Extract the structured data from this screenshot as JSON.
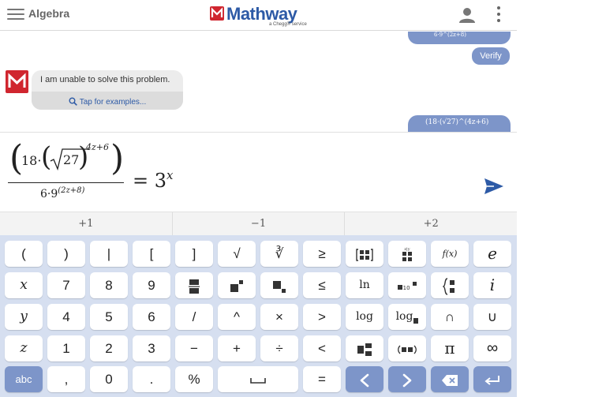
{
  "header": {
    "subject": "Algebra",
    "brand_name": "Mathway",
    "brand_sub": "a Chegg® service"
  },
  "chat": {
    "user_prev_fragment": "6·9^(2z+8)",
    "verify_label": "Verify",
    "bot_message": "I am unable to solve this problem.",
    "bot_link": "Tap for examples...",
    "user_next_fragment": "(18·(√27)^(4z+6)"
  },
  "input": {
    "coef": "18·",
    "radicand": "27",
    "exponent": "4z+6",
    "denominator_base": "6·9",
    "denominator_exp": "(2z+8)",
    "rhs_base": "= 3",
    "rhs_exp": "x"
  },
  "shortcuts": [
    "+1",
    "−1",
    "+2"
  ],
  "keys": {
    "row1": [
      "(",
      ")",
      "|",
      "[",
      "]",
      "√",
      "∛",
      "≥"
    ],
    "row2": [
      "x",
      "7",
      "8",
      "9",
      "",
      "",
      "",
      "≤",
      "ln",
      "",
      "",
      "i"
    ],
    "row3": [
      "y",
      "4",
      "5",
      "6",
      "/",
      "^",
      "×",
      ">",
      "log",
      "log",
      "∩",
      "∪"
    ],
    "row4": [
      "z",
      "1",
      "2",
      "3",
      "−",
      "+",
      "÷",
      "<",
      "",
      "",
      "π",
      "∞"
    ],
    "row5": [
      "abc",
      ",",
      "0",
      ".",
      "%",
      "",
      "="
    ],
    "fx": "f(x)",
    "e": "e"
  },
  "colors": {
    "brand_red": "#d0262f",
    "brand_blue": "#2d5aa6",
    "accent": "#7d95c9",
    "keypad_bg": "#d6dff0"
  }
}
